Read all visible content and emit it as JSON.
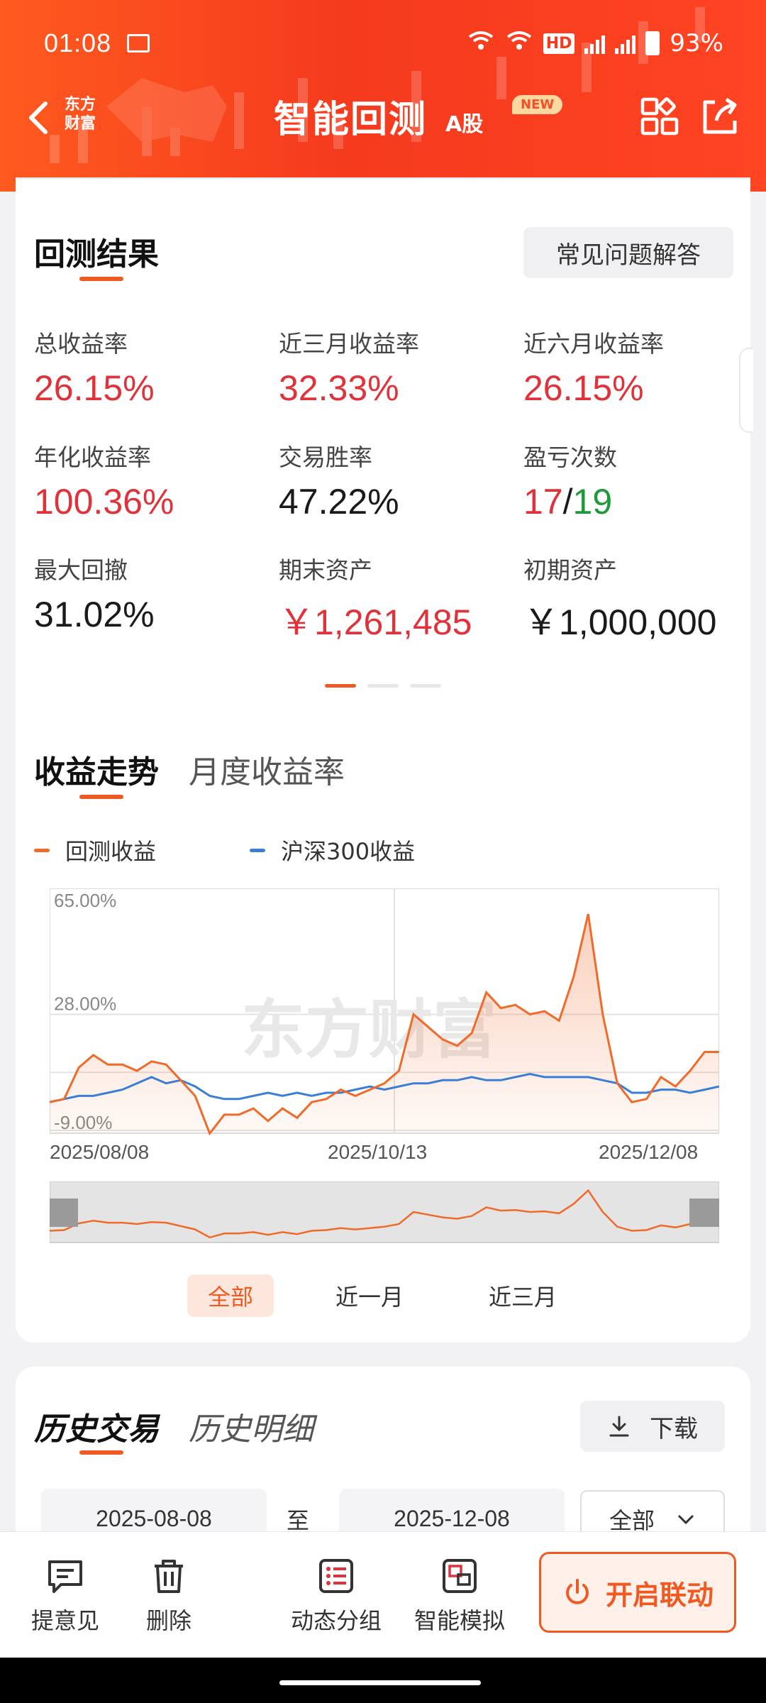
{
  "status_bar": {
    "time": "01:08",
    "battery": "93%",
    "wifi1": "6",
    "wifi2": "6",
    "hd": "HD",
    "net": "5G"
  },
  "header": {
    "brand_line1": "东方",
    "brand_line2": "财富",
    "title": "智能回测",
    "title_sub": "A股",
    "new_badge": "NEW"
  },
  "results": {
    "title": "回测结果",
    "faq_button": "常见问题解答",
    "metrics": [
      {
        "label": "总收益率",
        "value": "26.15%",
        "color": "red"
      },
      {
        "label": "近三月收益率",
        "value": "32.33%",
        "color": "red"
      },
      {
        "label": "近六月收益率",
        "value": "26.15%",
        "color": "red"
      },
      {
        "label": "年化收益率",
        "value": "100.36%",
        "color": "red"
      },
      {
        "label": "交易胜率",
        "value": "47.22%",
        "color": "dark"
      },
      {
        "label": "盈亏次数",
        "win": "17",
        "sep": "/",
        "loss": "19"
      },
      {
        "label": "最大回撤",
        "value": "31.02%",
        "color": "dark"
      },
      {
        "label": "期末资产",
        "value": "￥1,261,485",
        "color": "red"
      },
      {
        "label": "初期资产",
        "value": "￥1,000,000",
        "color": "dark"
      }
    ]
  },
  "trend": {
    "tab_active": "收益走势",
    "tab_inactive": "月度收益率",
    "legend_backtest": "回测收益",
    "legend_index": "沪深300收益",
    "watermark": "东方财富",
    "range_tabs": [
      "全部",
      "近一月",
      "近三月"
    ]
  },
  "chart_data": {
    "type": "area",
    "y_tick_labels": [
      "65.00%",
      "28.00%",
      "-9.00%"
    ],
    "x_tick_labels": [
      "2025/08/08",
      "2025/10/13",
      "2025/12/08"
    ],
    "ylim": [
      -9,
      65
    ],
    "grid": true,
    "legend_position": "top-left",
    "colors": {
      "backtest": "#f06a2a",
      "index": "#3a7fd5"
    },
    "series": [
      {
        "name": "回测收益",
        "values": [
          0,
          1,
          11,
          15,
          12,
          12,
          10,
          13,
          12,
          7,
          2,
          -10,
          -4,
          -4,
          -2,
          -6,
          -2,
          -5,
          0,
          1,
          4,
          2,
          4,
          6,
          10,
          28,
          24,
          20,
          18,
          22,
          35,
          30,
          31,
          28,
          29,
          26,
          40,
          60,
          28,
          6,
          0,
          1,
          8,
          5,
          10,
          16,
          16
        ]
      },
      {
        "name": "沪深300收益",
        "values": [
          0,
          1,
          2,
          2,
          3,
          4,
          6,
          8,
          6,
          7,
          5,
          2,
          1,
          1,
          2,
          3,
          2,
          3,
          2,
          3,
          3,
          4,
          5,
          4,
          5,
          6,
          6,
          7,
          7,
          8,
          7,
          7,
          8,
          9,
          8,
          8,
          8,
          8,
          7,
          6,
          3,
          3,
          4,
          4,
          3,
          4,
          5
        ]
      }
    ]
  },
  "history": {
    "tab_active": "历史交易",
    "tab_inactive": "历史明细",
    "download": "下载",
    "date_from": "2025-08-08",
    "to_label": "至",
    "date_to": "2025-12-08",
    "filter": "全部"
  },
  "toolbar": {
    "feedback": "提意见",
    "delete": "删除",
    "dynamic_group": "动态分组",
    "smart_sim": "智能模拟",
    "cta": "开启联动"
  }
}
